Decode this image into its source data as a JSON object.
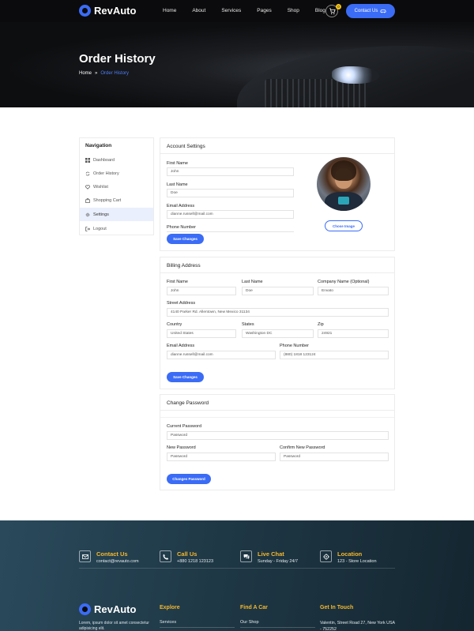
{
  "brand": {
    "name": "RevAuto"
  },
  "nav": {
    "items": [
      "Home",
      "About",
      "Services",
      "Pages",
      "Shop",
      "Blog"
    ]
  },
  "header": {
    "cart_count": "0",
    "contact_label": "Contact Us"
  },
  "hero": {
    "title": "Order History",
    "breadcrumb_home": "Home",
    "breadcrumb_sep": "»",
    "breadcrumb_current": "Order History"
  },
  "sidebar": {
    "title": "Navigation",
    "items": [
      {
        "label": "Dashboard",
        "icon": "grid-icon"
      },
      {
        "label": "Order History",
        "icon": "refresh-icon"
      },
      {
        "label": "Wishlist",
        "icon": "heart-icon"
      },
      {
        "label": "Shopping Cart",
        "icon": "bag-icon"
      },
      {
        "label": "Settings",
        "icon": "gear-icon"
      },
      {
        "label": "Logout",
        "icon": "logout-icon"
      }
    ],
    "active_index": 4
  },
  "account": {
    "title": "Account Settings",
    "first_name_label": "First Name",
    "first_name": "John",
    "last_name_label": "Last Name",
    "last_name": "Doe",
    "email_label": "Email Address",
    "email": "dianne.russell@mail.com",
    "phone_label": "Phone Number",
    "save_label": "Save Changes",
    "choose_image_label": "Chose Image"
  },
  "billing": {
    "title": "Billing Address",
    "first_name_label": "First Name",
    "first_name": "John",
    "last_name_label": "Last Name",
    "last_name": "Doe",
    "company_label": "Company Name (Optional)",
    "company": "Envato",
    "street_label": "Street Address",
    "street": "4140 Parker Rd. Allentown, New Mexico 31134",
    "country_label": "Country",
    "country": "United States",
    "states_label": "States",
    "states": "Washington DC",
    "zip_label": "Zip",
    "zip": "24921",
    "email_label": "Email Address",
    "email": "dianne.russell@mail.com",
    "phone_label": "Phone Number",
    "phone": "(880) 1818 123124",
    "save_label": "Save Changes"
  },
  "password": {
    "title": "Change Password",
    "current_label": "Current Password",
    "current_placeholder": "Password",
    "new_label": "New Password",
    "new_placeholder": "Password",
    "confirm_label": "Confirm New Password",
    "confirm_placeholder": "Password",
    "save_label": "Changes Password"
  },
  "footer": {
    "contacts": [
      {
        "title": "Contact Us",
        "sub": "contact@revauto.com",
        "icon": "mail-icon"
      },
      {
        "title": "Call Us",
        "sub": "+880 1218 123123",
        "icon": "phone-icon"
      },
      {
        "title": "Live Chat",
        "sub": "Sunday - Friday 24/7",
        "icon": "chat-icon"
      },
      {
        "title": "Location",
        "sub": "123 - Store Location",
        "icon": "location-icon"
      }
    ],
    "brand": "RevAuto",
    "about": "Lorem, ipsum dolor sit amet consectetur adipisicing elit.",
    "col_explore": "Explore",
    "explore_link": "Services",
    "col_find": "Find A Car",
    "find_link": "Our Shop",
    "col_touch": "Get In Touch",
    "address": "Valentin, Street Road 27, New York USA - 752252"
  },
  "colors": {
    "accent": "#3b6cf6",
    "gold": "#f5b82e",
    "dark": "#0b0b0d"
  }
}
